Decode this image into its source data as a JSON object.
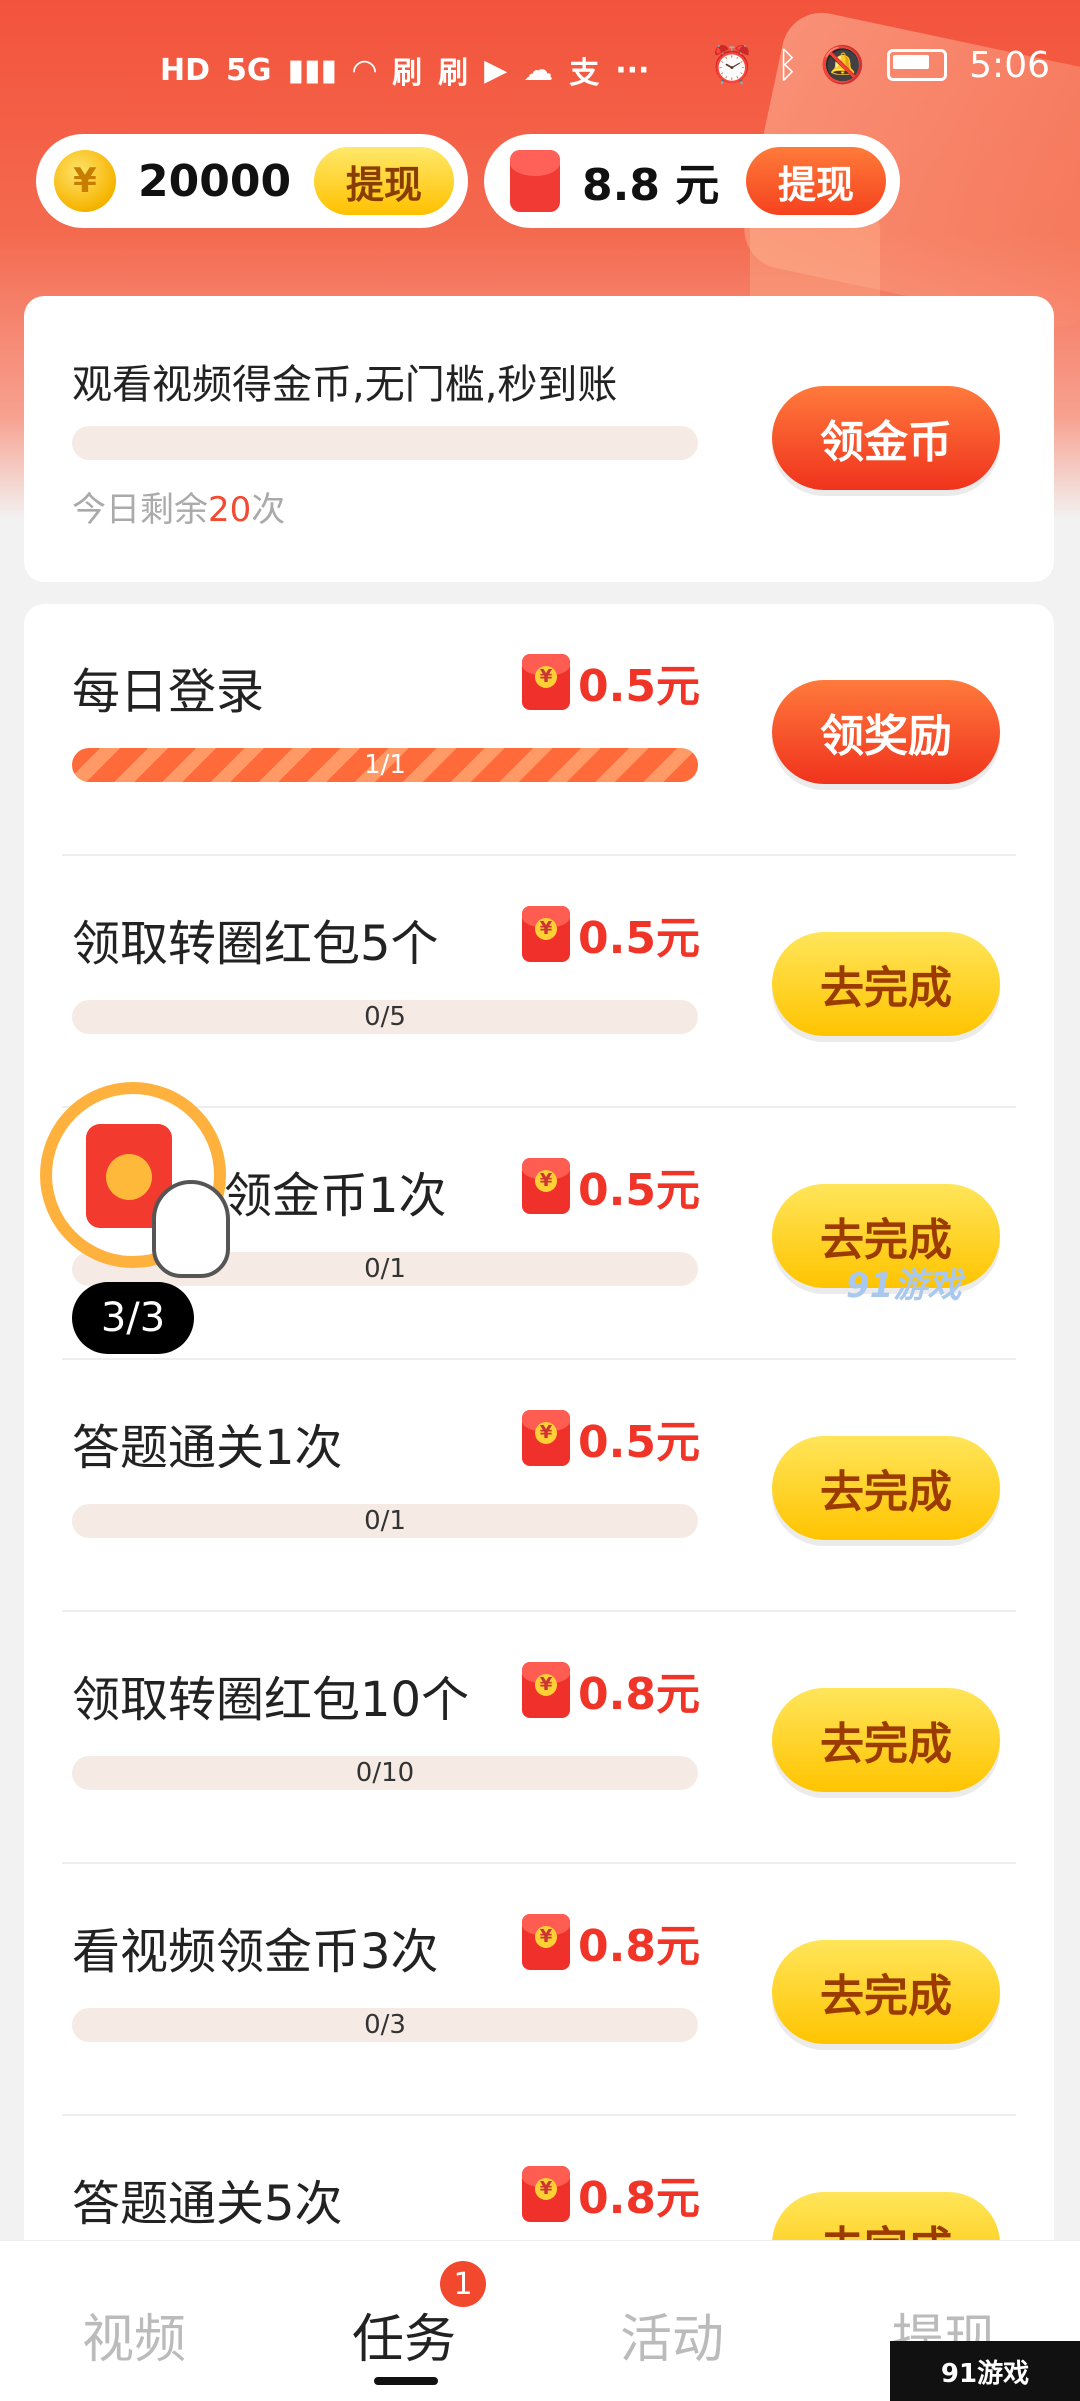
{
  "status_bar": {
    "left_icons": [
      "HD",
      "5G",
      "wifi",
      "刷",
      "刷",
      "video-app",
      "cloud-app",
      "支",
      "···"
    ],
    "time": "5:06"
  },
  "wallets": {
    "coin": {
      "value": "20000",
      "button": "提现"
    },
    "cash": {
      "value": "8.8 元",
      "button": "提现"
    }
  },
  "video_task": {
    "title": "观看视频得金币,无门槛,秒到账",
    "remain_prefix": "今日剩余",
    "remain_count": "20",
    "remain_suffix": "次",
    "button": "领金币"
  },
  "tasks": [
    {
      "title": "每日登录",
      "reward": "0.5元",
      "progress": "1/1",
      "progress_fraction": 1,
      "button": "领奖励"
    },
    {
      "title": "领取转圈红包5个",
      "reward": "0.5元",
      "progress": "0/5",
      "progress_fraction": 0,
      "button": "去完成"
    },
    {
      "title": "领金币1次",
      "reward": "0.5元",
      "progress": "0/1",
      "progress_fraction": 0,
      "button": "去完成"
    },
    {
      "title": "答题通关1次",
      "reward": "0.5元",
      "progress": "0/1",
      "progress_fraction": 0,
      "button": "去完成"
    },
    {
      "title": "领取转圈红包10个",
      "reward": "0.8元",
      "progress": "0/10",
      "progress_fraction": 0,
      "button": "去完成"
    },
    {
      "title": "看视频领金币3次",
      "reward": "0.8元",
      "progress": "0/3",
      "progress_fraction": 0,
      "button": "去完成"
    },
    {
      "title": "答题通关5次",
      "reward": "0.8元",
      "progress": "",
      "progress_fraction": 0,
      "button": "去完成"
    }
  ],
  "floating": {
    "count": "3/3"
  },
  "watermark": "91游戏",
  "nav": {
    "items": [
      "视频",
      "任务",
      "活动",
      "提现"
    ],
    "active": "任务",
    "badge": "1"
  },
  "corner_watermark": "91游戏",
  "colors": {
    "accent_red": "#f24b32",
    "button_yellow": "#ffc400",
    "brand_bg": "#f3533c"
  }
}
